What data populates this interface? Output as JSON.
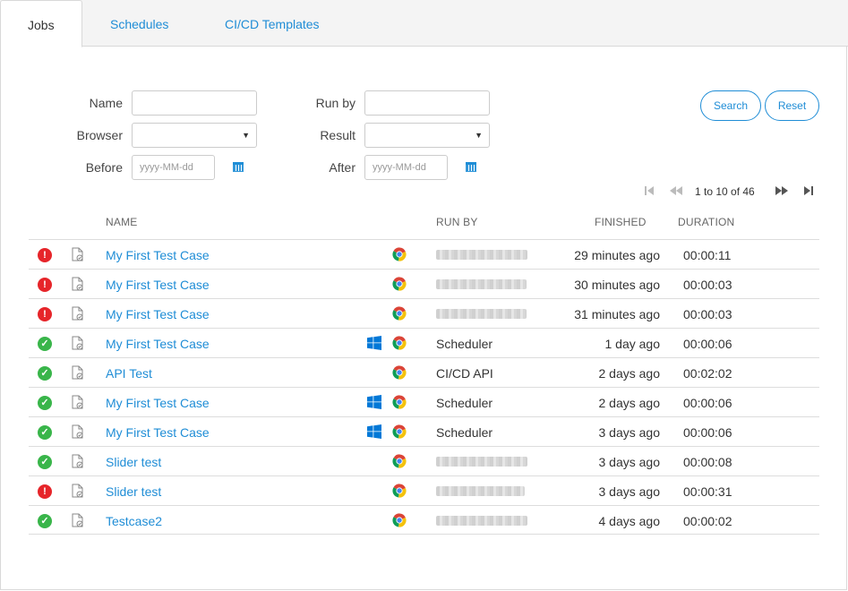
{
  "tabs": {
    "jobs": "Jobs",
    "schedules": "Schedules",
    "cicd": "CI/CD Templates"
  },
  "filters": {
    "name_label": "Name",
    "browser_label": "Browser",
    "before_label": "Before",
    "runby_label": "Run by",
    "result_label": "Result",
    "after_label": "After",
    "before_placeholder": "yyyy-MM-dd",
    "after_placeholder": "yyyy-MM-dd",
    "select_arrow": "▼"
  },
  "buttons": {
    "search": "Search",
    "reset": "Reset"
  },
  "pager": {
    "text": "1 to 10 of 46"
  },
  "columns": {
    "name": "NAME",
    "runby": "RUN BY",
    "finished": "FINISHED",
    "duration": "DURATION"
  },
  "rows": [
    {
      "status": "fail",
      "name": "My First Test Case",
      "windows": false,
      "runby": "",
      "blurred": true,
      "finished": "29 minutes ago",
      "duration": "00:00:11"
    },
    {
      "status": "fail",
      "name": "My First Test Case",
      "windows": false,
      "runby": "",
      "blurred": true,
      "finished": "30 minutes ago",
      "duration": "00:00:03"
    },
    {
      "status": "fail",
      "name": "My First Test Case",
      "windows": false,
      "runby": "",
      "blurred": true,
      "finished": "31 minutes ago",
      "duration": "00:00:03"
    },
    {
      "status": "pass",
      "name": "My First Test Case",
      "windows": true,
      "runby": "Scheduler",
      "blurred": false,
      "finished": "1 day ago",
      "duration": "00:00:06"
    },
    {
      "status": "pass",
      "name": "API Test",
      "windows": false,
      "runby": "CI/CD API",
      "blurred": false,
      "finished": "2 days ago",
      "duration": "00:02:02"
    },
    {
      "status": "pass",
      "name": "My First Test Case",
      "windows": true,
      "runby": "Scheduler",
      "blurred": false,
      "finished": "2 days ago",
      "duration": "00:00:06"
    },
    {
      "status": "pass",
      "name": "My First Test Case",
      "windows": true,
      "runby": "Scheduler",
      "blurred": false,
      "finished": "3 days ago",
      "duration": "00:00:06"
    },
    {
      "status": "pass",
      "name": "Slider test",
      "windows": false,
      "runby": "",
      "blurred": true,
      "finished": "3 days ago",
      "duration": "00:00:08"
    },
    {
      "status": "fail",
      "name": "Slider test",
      "windows": false,
      "runby": "",
      "blurred": true,
      "finished": "3 days ago",
      "duration": "00:00:31"
    },
    {
      "status": "pass",
      "name": "Testcase2",
      "windows": false,
      "runby": "",
      "blurred": true,
      "finished": "4 days ago",
      "duration": "00:00:02"
    }
  ],
  "colors": {
    "accent": "#1f8dd6",
    "fail": "#e6252a",
    "pass": "#39b54a"
  },
  "icons": {
    "fail": "!",
    "pass": "✓"
  }
}
